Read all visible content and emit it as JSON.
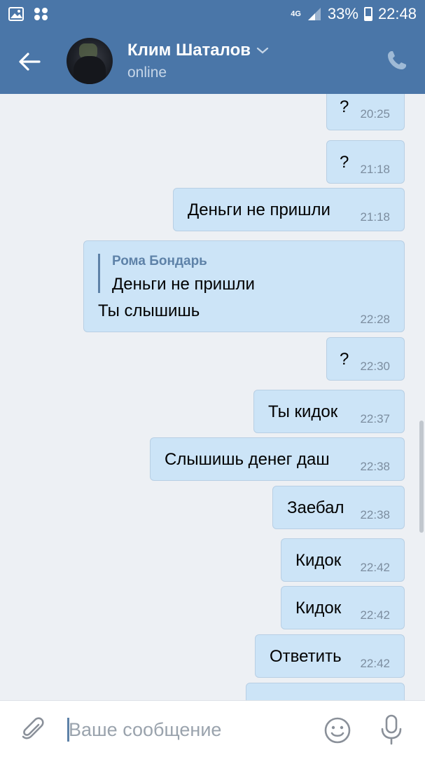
{
  "statusbar": {
    "network": "4G",
    "battery": "33%",
    "time": "22:48"
  },
  "header": {
    "name": "Клим Шаталов",
    "status": "online"
  },
  "messages": [
    {
      "text": "?",
      "time": "20:25"
    },
    {
      "text": "?",
      "time": "21:18"
    },
    {
      "text": "Деньги не пришли",
      "time": "21:18"
    },
    {
      "reply_author": "Рома Бондарь",
      "reply_text": "Деньги не пришли",
      "text": "Ты слышишь",
      "time": "22:28"
    },
    {
      "text": "?",
      "time": "22:30"
    },
    {
      "text": "Ты кидок",
      "time": "22:37"
    },
    {
      "text": "Слышишь денег даш",
      "time": "22:38"
    },
    {
      "text": "Заебал",
      "time": "22:38"
    },
    {
      "text": "Кидок",
      "time": "22:42"
    },
    {
      "text": "Кидок",
      "time": "22:42"
    },
    {
      "text": "Ответить",
      "time": "22:42"
    }
  ],
  "input": {
    "placeholder": "Ваше сообщение"
  },
  "colors": {
    "header": "#4a76a8",
    "bubble": "#cce4f7",
    "background": "#edf0f4"
  },
  "icons": [
    "image-icon",
    "app-grid-icon",
    "signal-icon",
    "battery-icon",
    "back-arrow-icon",
    "chevron-down-icon",
    "phone-icon",
    "paperclip-icon",
    "emoji-icon",
    "microphone-icon"
  ]
}
